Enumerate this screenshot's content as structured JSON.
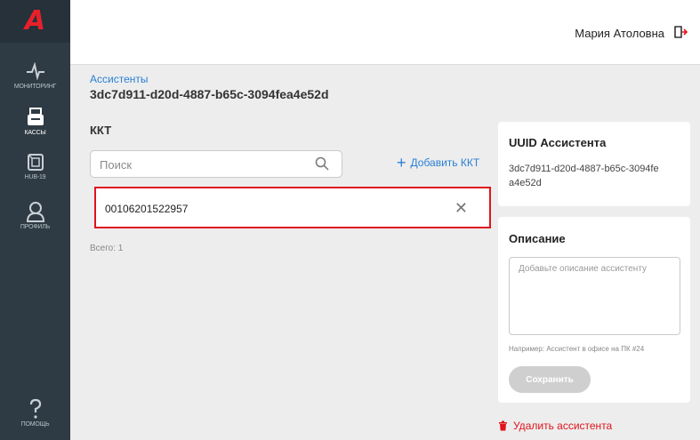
{
  "sidebar": {
    "logo": "A",
    "items": [
      {
        "label": "Мониторинг",
        "icon": "pulse-icon"
      },
      {
        "label": "Кассы",
        "icon": "printer-icon"
      },
      {
        "label": "HUB-19",
        "icon": "hub-icon"
      },
      {
        "label": "Профиль",
        "icon": "user-icon"
      }
    ],
    "help_label": "Помощь"
  },
  "header": {
    "user_name": "Мария Атоловна"
  },
  "breadcrumb": "Ассистенты",
  "page_title": "3dc7d911-d20d-4887-b65c-3094fea4e52d",
  "kkt_section": {
    "title": "ККТ",
    "search_placeholder": "Поиск",
    "add_label": "Добавить ККТ",
    "items": [
      {
        "number": "00106201522957"
      }
    ],
    "total": "Всего: 1"
  },
  "uuid_card": {
    "title": "UUID Ассистента",
    "value": "3dc7d911-d20d-4887-b65c-3094fea4e52d"
  },
  "description_card": {
    "title": "Описание",
    "placeholder": "Добавьте описание ассистенту",
    "hint": "Например: Ассистент в офисе на ПК #24",
    "save_label": "Сохранить"
  },
  "delete_label": "Удалить ассистента",
  "colors": {
    "sidebar": "#2f3b44",
    "accent_blue": "#2a7fd4",
    "accent_red": "#e0141c"
  }
}
